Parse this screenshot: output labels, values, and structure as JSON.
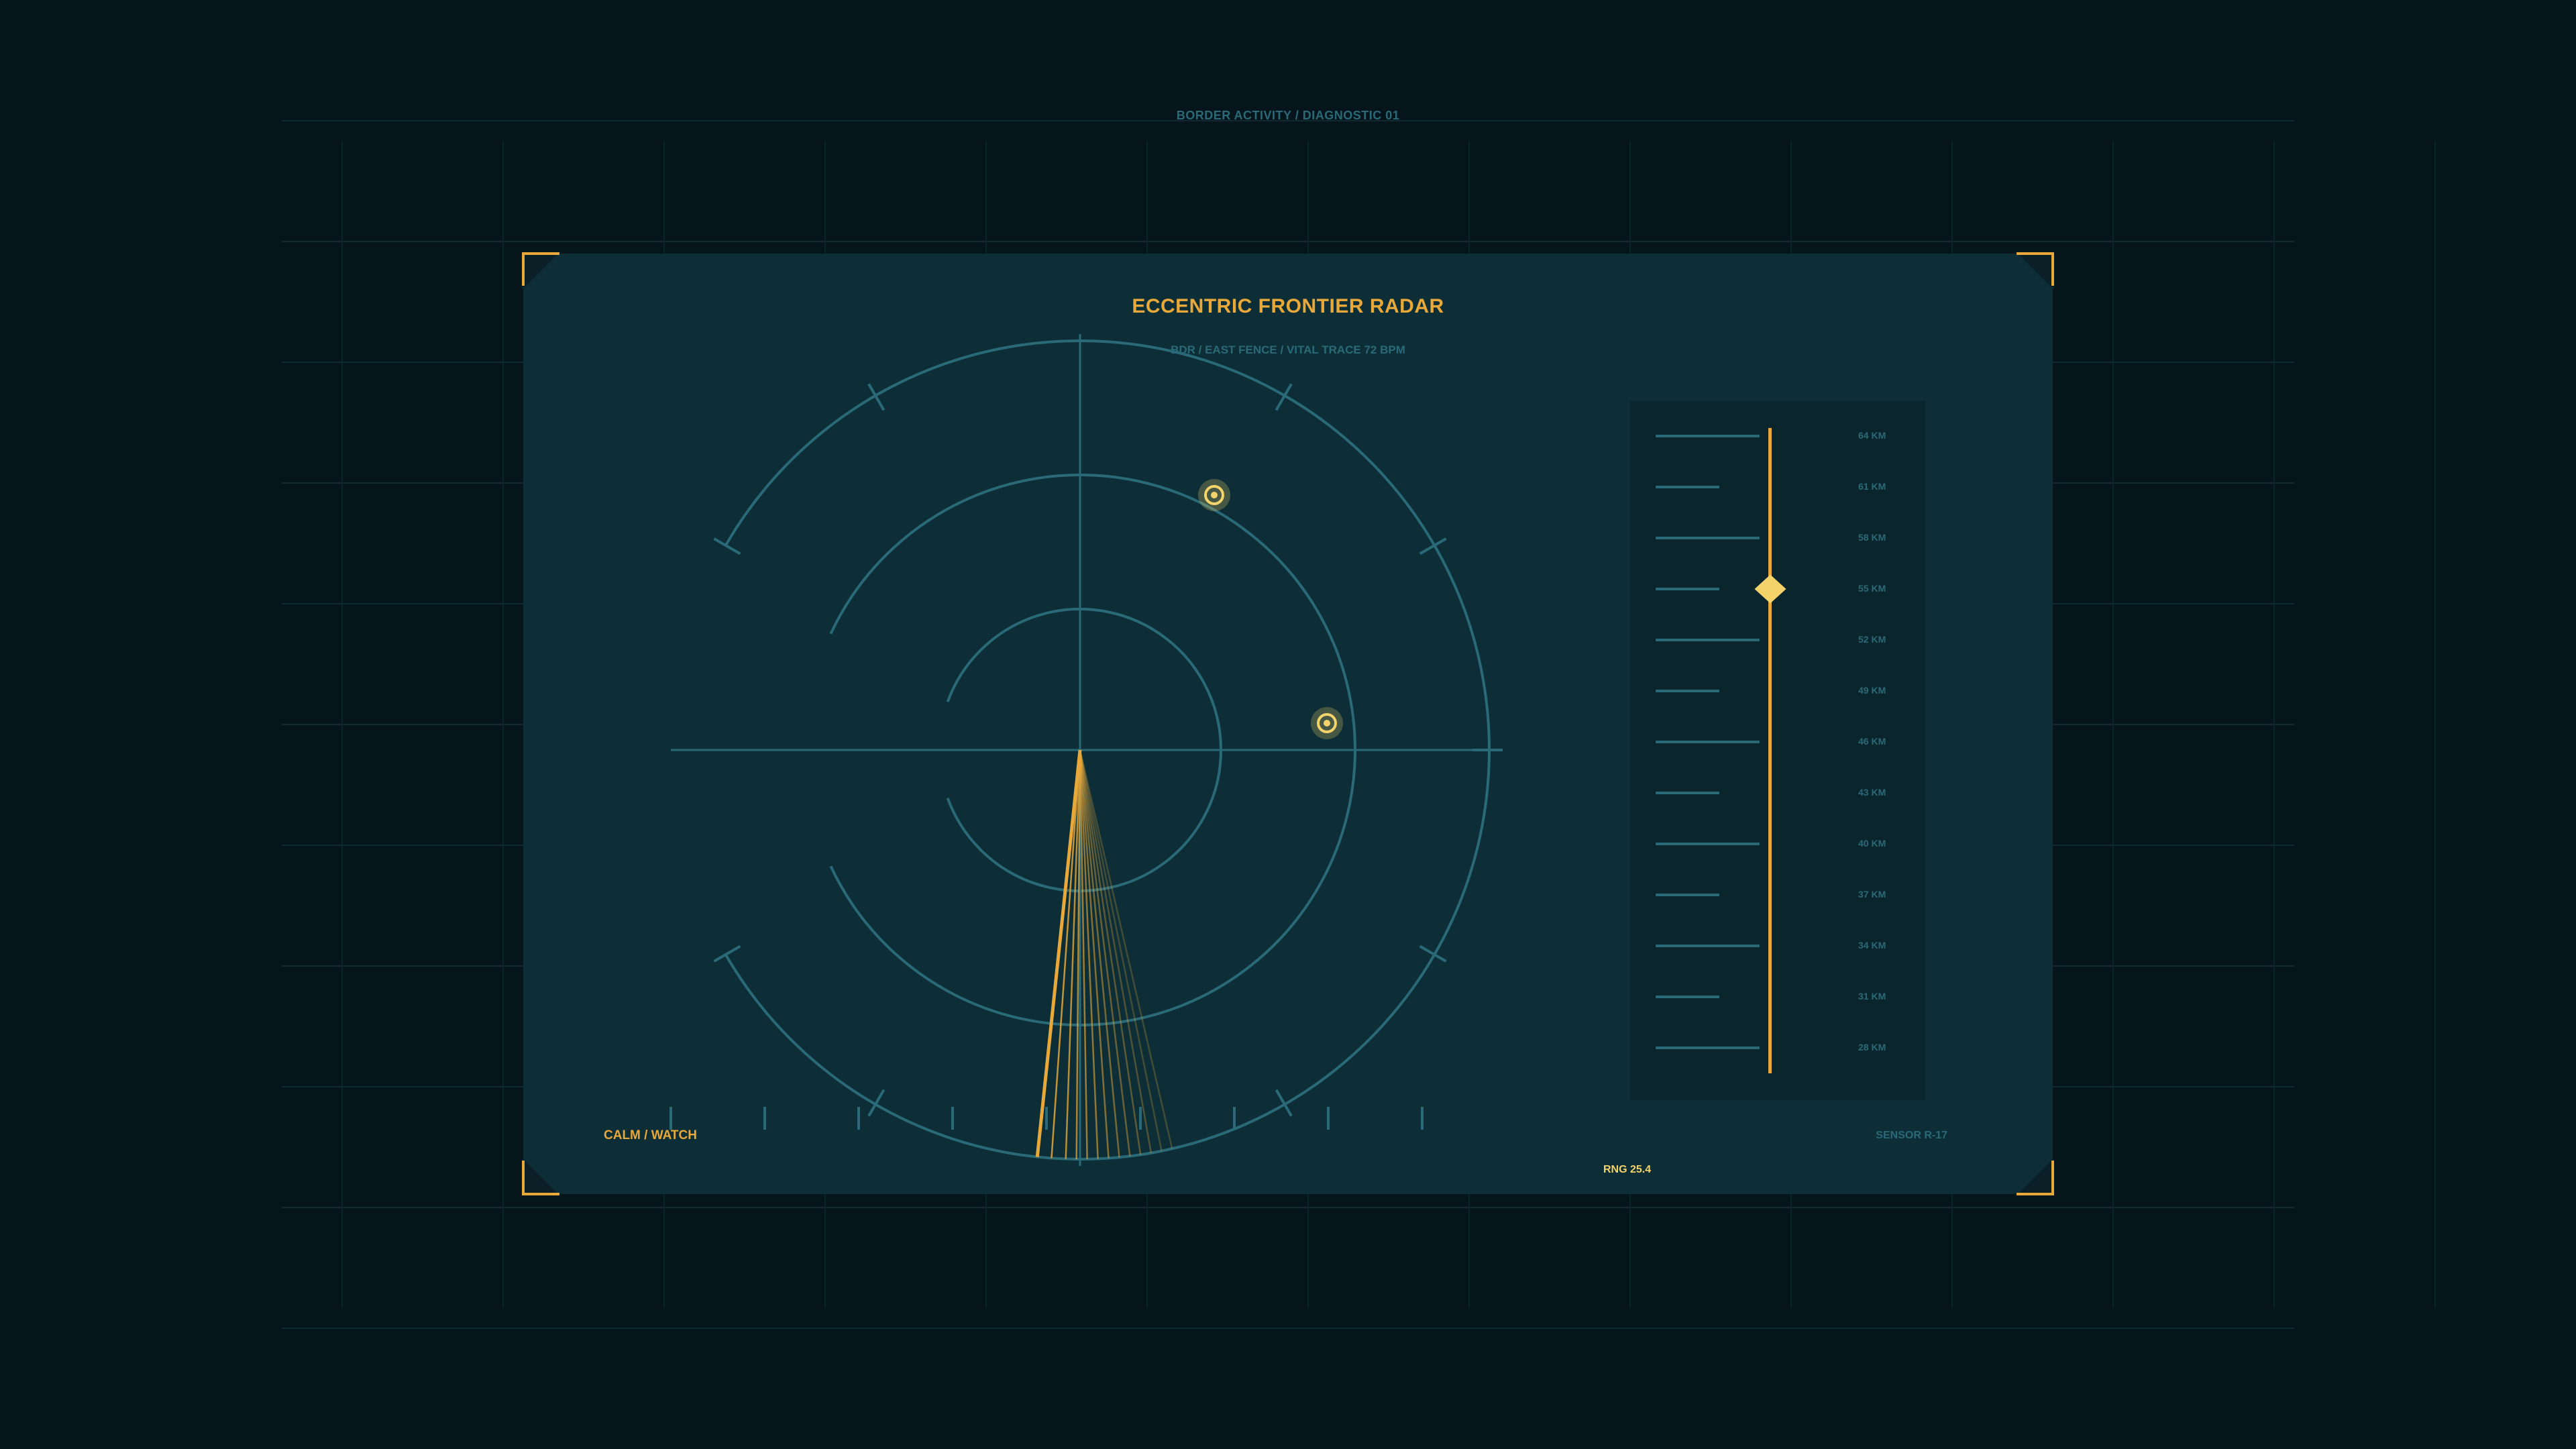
{
  "header": {
    "label": "BORDER ACTIVITY / DIAGNOSTIC 01"
  },
  "panel": {
    "title": "ECCENTRIC FRONTIER RADAR",
    "subtitle": "BDR / EAST FENCE / VITAL TRACE 72 BPM",
    "status": "CALM / WATCH",
    "sensor": "SENSOR R-17",
    "range_readout": "RNG 25.4"
  },
  "range_scale": {
    "labels": [
      "64 KM",
      "61 KM",
      "58 KM",
      "55 KM",
      "52 KM",
      "49 KM",
      "46 KM",
      "43 KM",
      "40 KM",
      "37 KM",
      "34 KM",
      "31 KM",
      "28 KM"
    ],
    "marker_value_km": 55
  },
  "radar": {
    "contacts": [
      {
        "name": "contact-1"
      },
      {
        "name": "contact-2"
      }
    ]
  },
  "colors": {
    "background": "#06151b",
    "panel": "#0d2e36",
    "grid": "#2a6a78",
    "accent": "#e8a93a",
    "highlight": "#f3d36a"
  },
  "icons": {
    "contact": "target-icon",
    "marker": "diamond-marker-icon"
  }
}
